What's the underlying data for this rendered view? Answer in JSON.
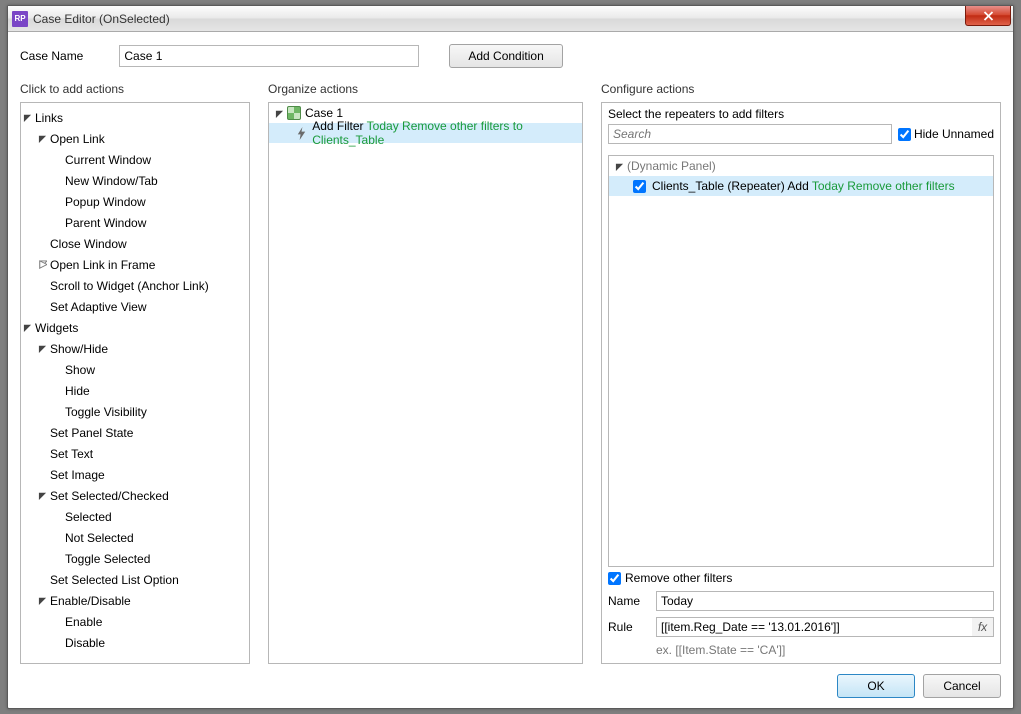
{
  "window": {
    "title": "Case Editor (OnSelected)",
    "app_icon_text": "RP"
  },
  "toprow": {
    "case_name_label": "Case Name",
    "case_name_value": "Case 1",
    "add_condition_label": "Add Condition"
  },
  "column_headers": {
    "actions": "Click to add actions",
    "organize": "Organize actions",
    "configure": "Configure actions"
  },
  "actions_tree": [
    {
      "depth": 0,
      "expand": "open",
      "label": "Links"
    },
    {
      "depth": 1,
      "expand": "open",
      "label": "Open Link"
    },
    {
      "depth": 2,
      "expand": "none",
      "label": "Current Window"
    },
    {
      "depth": 2,
      "expand": "none",
      "label": "New Window/Tab"
    },
    {
      "depth": 2,
      "expand": "none",
      "label": "Popup Window"
    },
    {
      "depth": 2,
      "expand": "none",
      "label": "Parent Window"
    },
    {
      "depth": 1,
      "expand": "none",
      "label": "Close Window"
    },
    {
      "depth": 1,
      "expand": "closed",
      "label": "Open Link in Frame"
    },
    {
      "depth": 1,
      "expand": "none",
      "label": "Scroll to Widget (Anchor Link)"
    },
    {
      "depth": 1,
      "expand": "none",
      "label": "Set Adaptive View"
    },
    {
      "depth": 0,
      "expand": "open",
      "label": "Widgets"
    },
    {
      "depth": 1,
      "expand": "open",
      "label": "Show/Hide"
    },
    {
      "depth": 2,
      "expand": "none",
      "label": "Show"
    },
    {
      "depth": 2,
      "expand": "none",
      "label": "Hide"
    },
    {
      "depth": 2,
      "expand": "none",
      "label": "Toggle Visibility"
    },
    {
      "depth": 1,
      "expand": "none",
      "label": "Set Panel State"
    },
    {
      "depth": 1,
      "expand": "none",
      "label": "Set Text"
    },
    {
      "depth": 1,
      "expand": "none",
      "label": "Set Image"
    },
    {
      "depth": 1,
      "expand": "open",
      "label": "Set Selected/Checked"
    },
    {
      "depth": 2,
      "expand": "none",
      "label": "Selected"
    },
    {
      "depth": 2,
      "expand": "none",
      "label": "Not Selected"
    },
    {
      "depth": 2,
      "expand": "none",
      "label": "Toggle Selected"
    },
    {
      "depth": 1,
      "expand": "none",
      "label": "Set Selected List Option"
    },
    {
      "depth": 1,
      "expand": "open",
      "label": "Enable/Disable"
    },
    {
      "depth": 2,
      "expand": "none",
      "label": "Enable"
    },
    {
      "depth": 2,
      "expand": "none",
      "label": "Disable"
    }
  ],
  "organize": {
    "case_label": "Case 1",
    "action_prefix": "Add Filter ",
    "action_green": "Today Remove other filters to Clients_Table"
  },
  "configure": {
    "header": "Select the repeaters to add filters",
    "search_placeholder": "Search",
    "hide_unnamed_label": "Hide Unnamed",
    "hide_unnamed_checked": true,
    "tree_group": "(Dynamic Panel)",
    "tree_item_prefix": "Clients_Table (Repeater) Add ",
    "tree_item_green": "Today Remove other filters",
    "tree_item_checked": true,
    "remove_filters_label": "Remove other filters",
    "remove_filters_checked": true,
    "name_label": "Name",
    "name_value": "Today",
    "rule_label": "Rule",
    "rule_value": "[[item.Reg_Date == '13.01.2016']]",
    "fx_label": "fx",
    "example": "ex. [[Item.State == 'CA']]"
  },
  "footer": {
    "ok": "OK",
    "cancel": "Cancel"
  }
}
